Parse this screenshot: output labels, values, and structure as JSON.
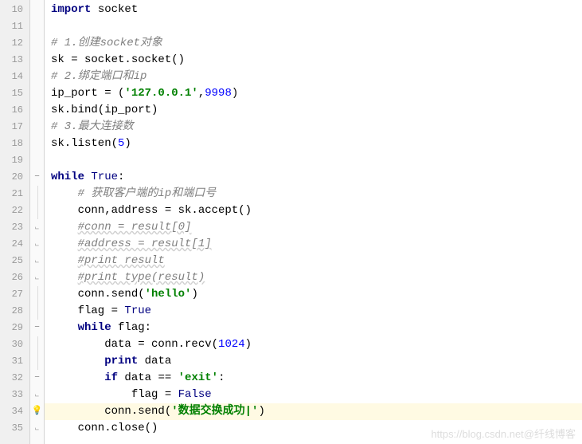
{
  "lines": [
    {
      "num": "10",
      "fold": "none",
      "tokens": [
        {
          "t": "kw",
          "v": "import"
        },
        {
          "t": "",
          "v": " socket"
        }
      ]
    },
    {
      "num": "11",
      "fold": "none",
      "tokens": []
    },
    {
      "num": "12",
      "fold": "none",
      "tokens": [
        {
          "t": "com",
          "v": "# 1.创建socket对象"
        }
      ]
    },
    {
      "num": "13",
      "fold": "none",
      "tokens": [
        {
          "t": "",
          "v": "sk = socket.socket()"
        }
      ]
    },
    {
      "num": "14",
      "fold": "none",
      "tokens": [
        {
          "t": "com",
          "v": "# 2.绑定端口和ip"
        }
      ]
    },
    {
      "num": "15",
      "fold": "none",
      "tokens": [
        {
          "t": "",
          "v": "ip_port = ("
        },
        {
          "t": "str",
          "v": "'127.0.0.1'"
        },
        {
          "t": "",
          "v": ","
        },
        {
          "t": "num",
          "v": "9998"
        },
        {
          "t": "",
          "v": ")"
        }
      ]
    },
    {
      "num": "16",
      "fold": "none",
      "tokens": [
        {
          "t": "",
          "v": "sk.bind(ip_port)"
        }
      ]
    },
    {
      "num": "17",
      "fold": "none",
      "tokens": [
        {
          "t": "com",
          "v": "# 3.最大连接数"
        }
      ]
    },
    {
      "num": "18",
      "fold": "none",
      "tokens": [
        {
          "t": "",
          "v": "sk.listen("
        },
        {
          "t": "num",
          "v": "5"
        },
        {
          "t": "",
          "v": ")"
        }
      ]
    },
    {
      "num": "19",
      "fold": "none",
      "tokens": []
    },
    {
      "num": "20",
      "fold": "minus",
      "indent": 0,
      "tokens": [
        {
          "t": "kw",
          "v": "while"
        },
        {
          "t": "",
          "v": " "
        },
        {
          "t": "bool",
          "v": "True"
        },
        {
          "t": "",
          "v": ":"
        }
      ]
    },
    {
      "num": "21",
      "fold": "line",
      "indent": 1,
      "tokens": [
        {
          "t": "com",
          "v": "# 获取客户端的ip和端口号"
        }
      ]
    },
    {
      "num": "22",
      "fold": "line",
      "indent": 1,
      "tokens": [
        {
          "t": "",
          "v": "conn,address = sk.accept()"
        }
      ]
    },
    {
      "num": "23",
      "fold": "end",
      "indent": 1,
      "tokens": [
        {
          "t": "com-wavy",
          "v": "#conn = result[0]"
        }
      ]
    },
    {
      "num": "24",
      "fold": "end",
      "indent": 1,
      "tokens": [
        {
          "t": "com-wavy",
          "v": "#address = result[1]"
        }
      ]
    },
    {
      "num": "25",
      "fold": "end",
      "indent": 1,
      "tokens": [
        {
          "t": "com-wavy",
          "v": "#print result"
        }
      ]
    },
    {
      "num": "26",
      "fold": "end",
      "indent": 1,
      "tokens": [
        {
          "t": "com-wavy",
          "v": "#print type(result)"
        }
      ]
    },
    {
      "num": "27",
      "fold": "line",
      "indent": 1,
      "tokens": [
        {
          "t": "",
          "v": "conn.send("
        },
        {
          "t": "str",
          "v": "'hello'"
        },
        {
          "t": "",
          "v": ")"
        }
      ]
    },
    {
      "num": "28",
      "fold": "line",
      "indent": 1,
      "tokens": [
        {
          "t": "",
          "v": "flag = "
        },
        {
          "t": "bool",
          "v": "True"
        }
      ]
    },
    {
      "num": "29",
      "fold": "minus",
      "indent": 1,
      "tokens": [
        {
          "t": "kw",
          "v": "while"
        },
        {
          "t": "",
          "v": " flag:"
        }
      ]
    },
    {
      "num": "30",
      "fold": "line",
      "indent": 2,
      "tokens": [
        {
          "t": "",
          "v": "data = conn.recv("
        },
        {
          "t": "num",
          "v": "1024"
        },
        {
          "t": "",
          "v": ")"
        }
      ]
    },
    {
      "num": "31",
      "fold": "line",
      "indent": 2,
      "tokens": [
        {
          "t": "kw",
          "v": "print"
        },
        {
          "t": "",
          "v": " data"
        }
      ]
    },
    {
      "num": "32",
      "fold": "minus",
      "indent": 2,
      "tokens": [
        {
          "t": "kw",
          "v": "if"
        },
        {
          "t": "",
          "v": " data == "
        },
        {
          "t": "str",
          "v": "'exit'"
        },
        {
          "t": "",
          "v": ":"
        }
      ]
    },
    {
      "num": "33",
      "fold": "end",
      "indent": 3,
      "tokens": [
        {
          "t": "",
          "v": "flag = "
        },
        {
          "t": "bool",
          "v": "False"
        }
      ]
    },
    {
      "num": "34",
      "fold": "bulb",
      "indent": 2,
      "highlighted": true,
      "tokens": [
        {
          "t": "",
          "v": "conn.send("
        },
        {
          "t": "str",
          "v": "'数据交换成功|'"
        },
        {
          "t": "",
          "v": ")"
        }
      ]
    },
    {
      "num": "35",
      "fold": "end",
      "indent": 1,
      "tokens": [
        {
          "t": "",
          "v": "conn.close()"
        }
      ]
    }
  ],
  "watermark": "https://blog.csdn.net@纤线博客",
  "indent_unit": "    "
}
